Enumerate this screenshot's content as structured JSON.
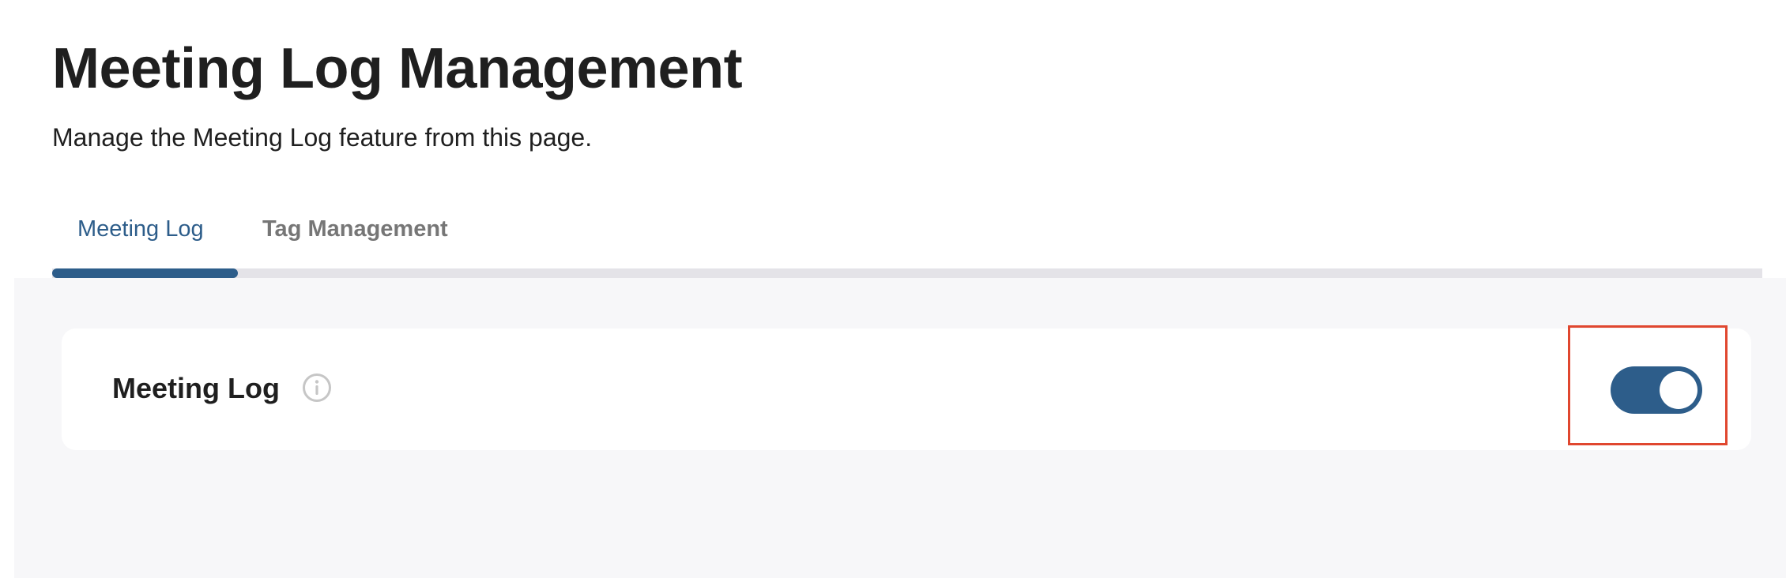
{
  "header": {
    "title": "Meeting Log Management",
    "subtitle": "Manage the Meeting Log feature from this page."
  },
  "tabs": [
    {
      "label": "Meeting Log",
      "active": true
    },
    {
      "label": "Tag Management",
      "active": false
    }
  ],
  "feature_card": {
    "title": "Meeting Log",
    "info_icon": "info-circle-icon",
    "toggle_enabled": true
  },
  "colors": {
    "accent": "#2d5d8a",
    "highlight": "#e0472f",
    "content_background": "#f7f7f9",
    "tab_track": "#e4e3e8"
  }
}
